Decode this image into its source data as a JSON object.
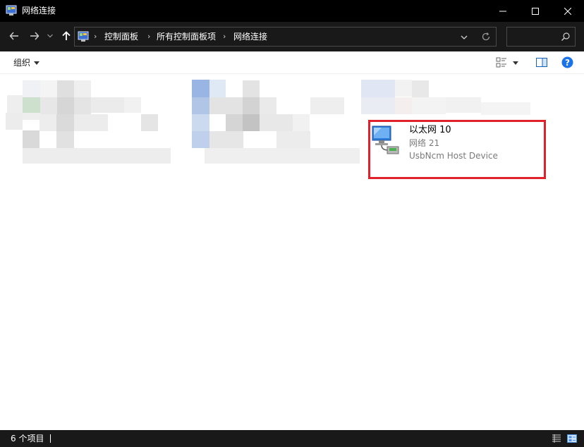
{
  "window": {
    "title": "网络连接",
    "controls": {
      "minimize": "minimize",
      "maximize": "maximize",
      "close": "close"
    }
  },
  "nav": {
    "breadcrumbs": [
      "控制面板",
      "所有控制面板项",
      "网络连接"
    ],
    "separator": "›",
    "search_placeholder": ""
  },
  "toolbar": {
    "organize_label": "组织"
  },
  "items": [
    {
      "name": "以太网 10",
      "status": "网络 21",
      "device": "UsbNcm Host Device",
      "selected": true
    }
  ],
  "status": {
    "count_text": "6 个项目"
  },
  "colors": {
    "titlebar": "#000000",
    "navbar": "#191919",
    "highlight": "#e0202a",
    "help": "#1a73e8"
  },
  "icons": [
    "control-panel-icon",
    "back-arrow-icon",
    "forward-arrow-icon",
    "chevron-down-icon",
    "up-arrow-icon",
    "refresh-icon",
    "search-icon",
    "view-options-icon",
    "preview-pane-icon",
    "help-icon",
    "network-adapter-icon",
    "details-view-icon",
    "tiles-view-icon"
  ]
}
